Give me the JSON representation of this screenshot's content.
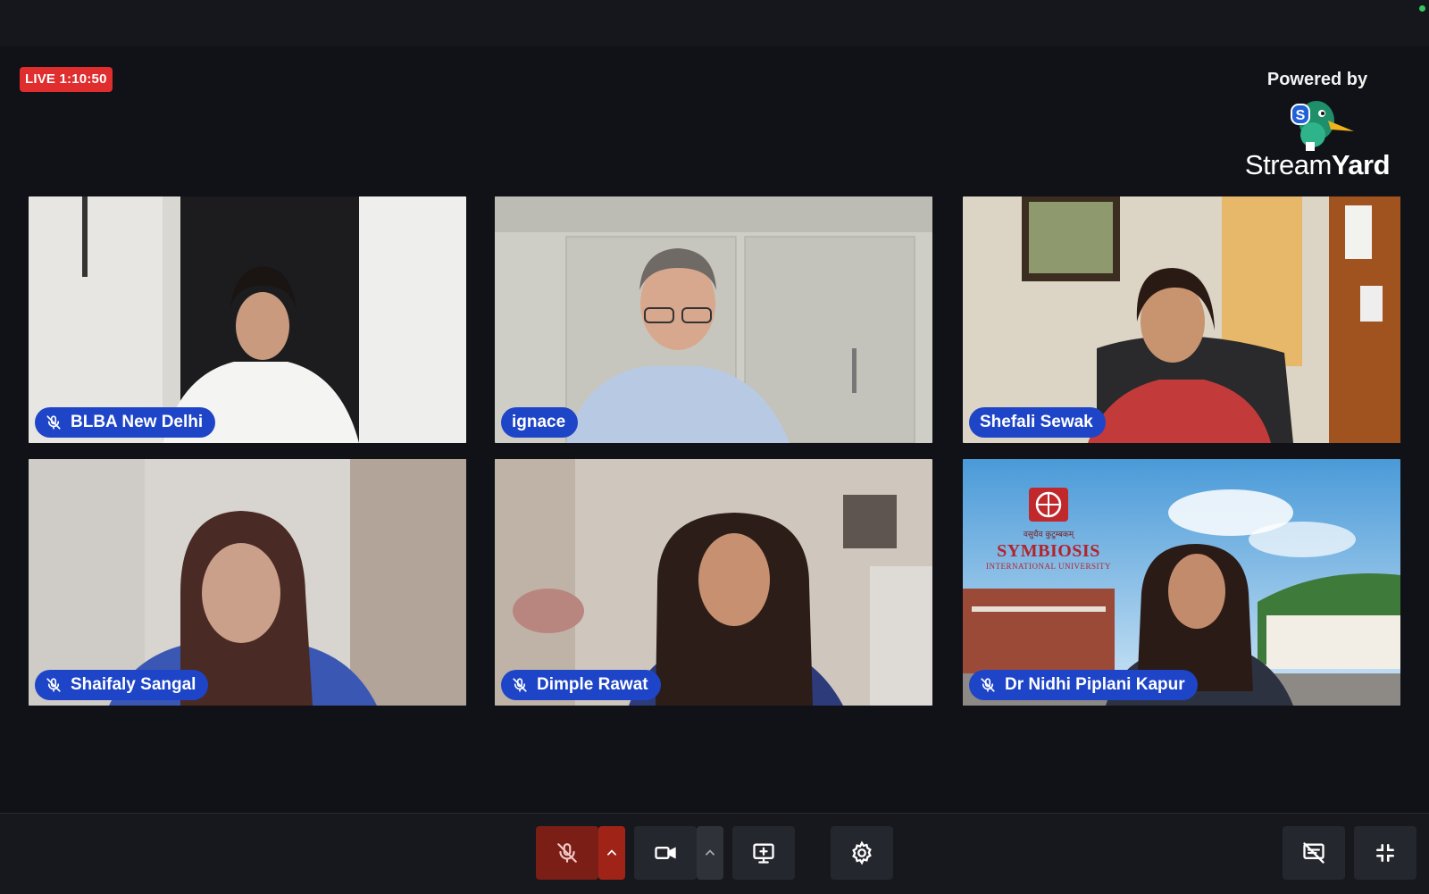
{
  "live": {
    "label": "LIVE 1:10:50"
  },
  "branding": {
    "powered_by": "Powered by",
    "brand_part1": "Stream",
    "brand_part2": "Yard"
  },
  "participants": [
    {
      "name": "BLBA New Delhi",
      "muted": true
    },
    {
      "name": "ignace",
      "muted": false
    },
    {
      "name": "Shefali Sewak",
      "muted": false
    },
    {
      "name": "Shaifaly Sangal",
      "muted": true
    },
    {
      "name": "Dimple Rawat",
      "muted": true
    },
    {
      "name": "Dr Nidhi Piplani Kapur",
      "muted": true
    }
  ],
  "background_logo": {
    "sanskrit": "वसुधैव कुटुम्बकम्",
    "title": "SYMBIOSIS",
    "subtitle": "INTERNATIONAL UNIVERSITY"
  },
  "controls": {
    "mic": {
      "icon": "mic-off-icon",
      "state": "muted"
    },
    "mic_options": {
      "icon": "chevron-up-icon"
    },
    "camera": {
      "icon": "video-camera-icon"
    },
    "camera_options": {
      "icon": "chevron-up-icon"
    },
    "share_screen": {
      "icon": "screen-share-icon"
    },
    "settings": {
      "icon": "gear-icon"
    },
    "hide_chat": {
      "icon": "chat-hidden-icon"
    },
    "exit_fullscreen": {
      "icon": "collapse-icon"
    }
  },
  "colors": {
    "background": "#111217",
    "live_red": "#e02d2d",
    "nametag_blue": "#1e45c7",
    "mic_muted_red": "#7a1e16"
  }
}
